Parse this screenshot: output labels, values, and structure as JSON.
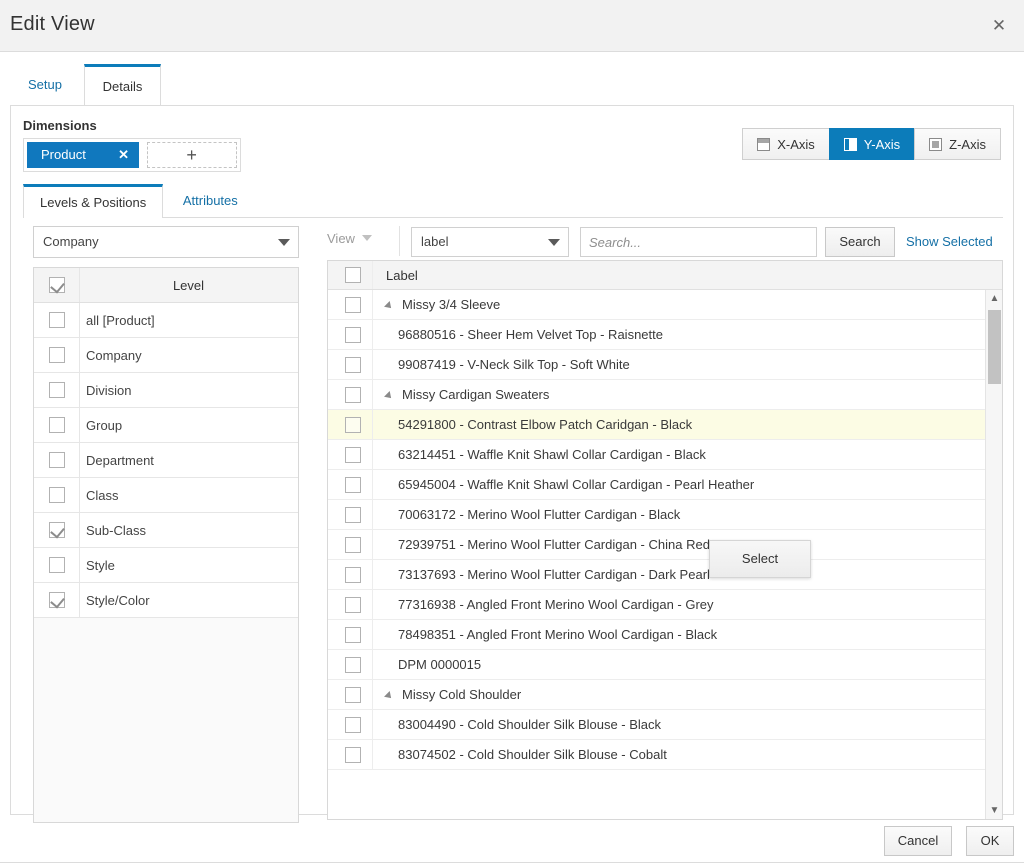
{
  "dialog": {
    "title": "Edit View",
    "close_icon": "close-icon"
  },
  "outer_tabs": [
    {
      "label": "Setup",
      "active": false
    },
    {
      "label": "Details",
      "active": true
    }
  ],
  "dimensions": {
    "heading": "Dimensions",
    "chips": [
      {
        "label": "Product",
        "remove_icon": "close-icon"
      }
    ],
    "add_label": "+"
  },
  "axes": [
    {
      "label": "X-Axis",
      "icon": "x-axis-icon",
      "active": false
    },
    {
      "label": "Y-Axis",
      "icon": "y-axis-icon",
      "active": true
    },
    {
      "label": "Z-Axis",
      "icon": "z-axis-icon",
      "active": false
    }
  ],
  "inner_tabs": [
    {
      "label": "Levels & Positions",
      "active": true
    },
    {
      "label": "Attributes",
      "active": false
    }
  ],
  "levels_panel": {
    "select_value": "Company",
    "column_header": "Level",
    "header_checked": true,
    "rows": [
      {
        "label": "all [Product]",
        "checked": false
      },
      {
        "label": "Company",
        "checked": false
      },
      {
        "label": "Division",
        "checked": false
      },
      {
        "label": "Group",
        "checked": false
      },
      {
        "label": "Department",
        "checked": false
      },
      {
        "label": "Class",
        "checked": false
      },
      {
        "label": "Sub-Class",
        "checked": true
      },
      {
        "label": "Style",
        "checked": false
      },
      {
        "label": "Style/Color",
        "checked": true
      }
    ]
  },
  "members_panel": {
    "view_label": "View",
    "field_value": "label",
    "search_placeholder": "Search...",
    "search_value": "",
    "search_button": "Search",
    "show_selected": "Show Selected",
    "column_header": "Label",
    "header_checked": false,
    "rows": [
      {
        "label": "Missy 3/4 Sleeve",
        "type": "group",
        "checked": false,
        "highlight": false
      },
      {
        "label": "96880516 - Sheer Hem Velvet Top - Raisnette",
        "type": "item",
        "checked": false,
        "highlight": false
      },
      {
        "label": "99087419 - V-Neck Silk Top - Soft White",
        "type": "item",
        "checked": false,
        "highlight": false
      },
      {
        "label": "Missy Cardigan Sweaters",
        "type": "group",
        "checked": false,
        "highlight": false
      },
      {
        "label": "54291800 - Contrast Elbow Patch Caridgan - Black",
        "type": "item",
        "checked": false,
        "highlight": true
      },
      {
        "label": "63214451 - Waffle Knit Shawl Collar Cardigan - Black",
        "type": "item",
        "checked": false,
        "highlight": false
      },
      {
        "label": "65945004 - Waffle Knit Shawl Collar Cardigan - Pearl Heather",
        "type": "item",
        "checked": false,
        "highlight": false
      },
      {
        "label": "70063172 - Merino Wool Flutter Cardigan - Black",
        "type": "item",
        "checked": false,
        "highlight": false
      },
      {
        "label": "72939751 - Merino Wool Flutter Cardigan - China Red",
        "type": "item",
        "checked": false,
        "highlight": false
      },
      {
        "label": "73137693 - Merino Wool Flutter Cardigan - Dark Pearl",
        "type": "item",
        "checked": false,
        "highlight": false
      },
      {
        "label": "77316938 - Angled Front Merino Wool Cardigan - Grey",
        "type": "item",
        "checked": false,
        "highlight": false
      },
      {
        "label": "78498351 - Angled Front Merino Wool Cardigan - Black",
        "type": "item",
        "checked": false,
        "highlight": false
      },
      {
        "label": "DPM 0000015",
        "type": "item",
        "checked": false,
        "highlight": false
      },
      {
        "label": "Missy Cold Shoulder",
        "type": "group",
        "checked": false,
        "highlight": false
      },
      {
        "label": "83004490 - Cold Shoulder Silk Blouse - Black",
        "type": "item",
        "checked": false,
        "highlight": false
      },
      {
        "label": "83074502 - Cold Shoulder Silk Blouse - Cobalt",
        "type": "item",
        "checked": false,
        "highlight": false
      }
    ],
    "scroll_up_icon": "chevron-up-icon",
    "scroll_down_icon": "chevron-down-icon"
  },
  "context_menu": {
    "items": [
      {
        "label": "Select"
      }
    ]
  },
  "footer": {
    "cancel_label": "Cancel",
    "ok_label": "OK"
  },
  "colors": {
    "accent": "#0c7cba",
    "chip": "#1078be",
    "link": "#1570a6",
    "highlight_row": "#fcfce4"
  }
}
